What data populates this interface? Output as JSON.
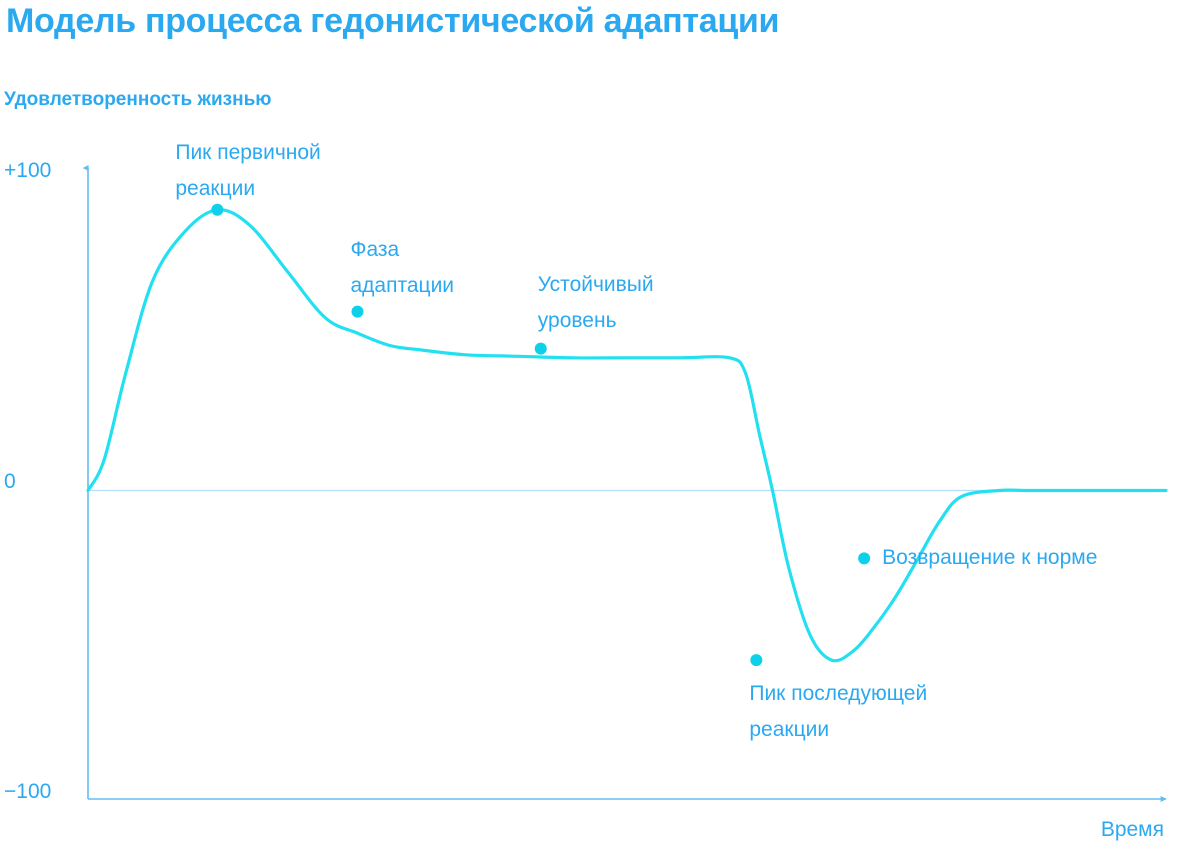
{
  "colors": {
    "title": "#2ba9f0",
    "text": "#2ba9f0",
    "axis": "#63bdf2",
    "zero_line": "#b3def8",
    "curve": "#22e0f0",
    "marker": "#0fd0ea"
  },
  "chart_data": {
    "type": "line",
    "title": "Модель процесса гедонистической адаптации",
    "ylabel": "Удовлетворенность жизнью",
    "xlabel": "Время",
    "ylim": [
      -100,
      100
    ],
    "xlim": [
      0,
      100
    ],
    "y_ticks": [
      "+100",
      "0",
      "−100"
    ],
    "y_tick_values": [
      100,
      0,
      -100
    ],
    "grid": false,
    "legend": "none",
    "series": [
      {
        "x": [
          0,
          1.5,
          3.5,
          6,
          9,
          12,
          15,
          18.5,
          22,
          25,
          28,
          31,
          35,
          40,
          45,
          50,
          55,
          59.5,
          61,
          62.3,
          63.5,
          65,
          67,
          69,
          71,
          73,
          75,
          77,
          79,
          81,
          84.5,
          87,
          90,
          95,
          100
        ],
        "y": [
          0,
          10,
          38,
          68,
          84,
          91,
          86,
          71,
          56,
          51,
          47,
          45.5,
          44,
          43.5,
          43,
          43,
          43,
          43,
          38,
          18,
          0,
          -25,
          -47,
          -55,
          -52,
          -44,
          -34,
          -22,
          -10,
          -2,
          0,
          0,
          0,
          0,
          0
        ]
      }
    ],
    "points": [
      {
        "x": 12,
        "y": 91,
        "label": [
          "Пик первичной",
          "реакции"
        ]
      },
      {
        "x": 25,
        "y": 58,
        "label": [
          "Фаза",
          "адаптации"
        ]
      },
      {
        "x": 42,
        "y": 46,
        "label": [
          "Устойчивый",
          "уровень"
        ]
      },
      {
        "x": 62,
        "y": -55,
        "label": [
          "Пик последующей",
          "реакции"
        ]
      },
      {
        "x": 72,
        "y": -22,
        "label": [
          "Возвращение к норме"
        ]
      }
    ]
  }
}
